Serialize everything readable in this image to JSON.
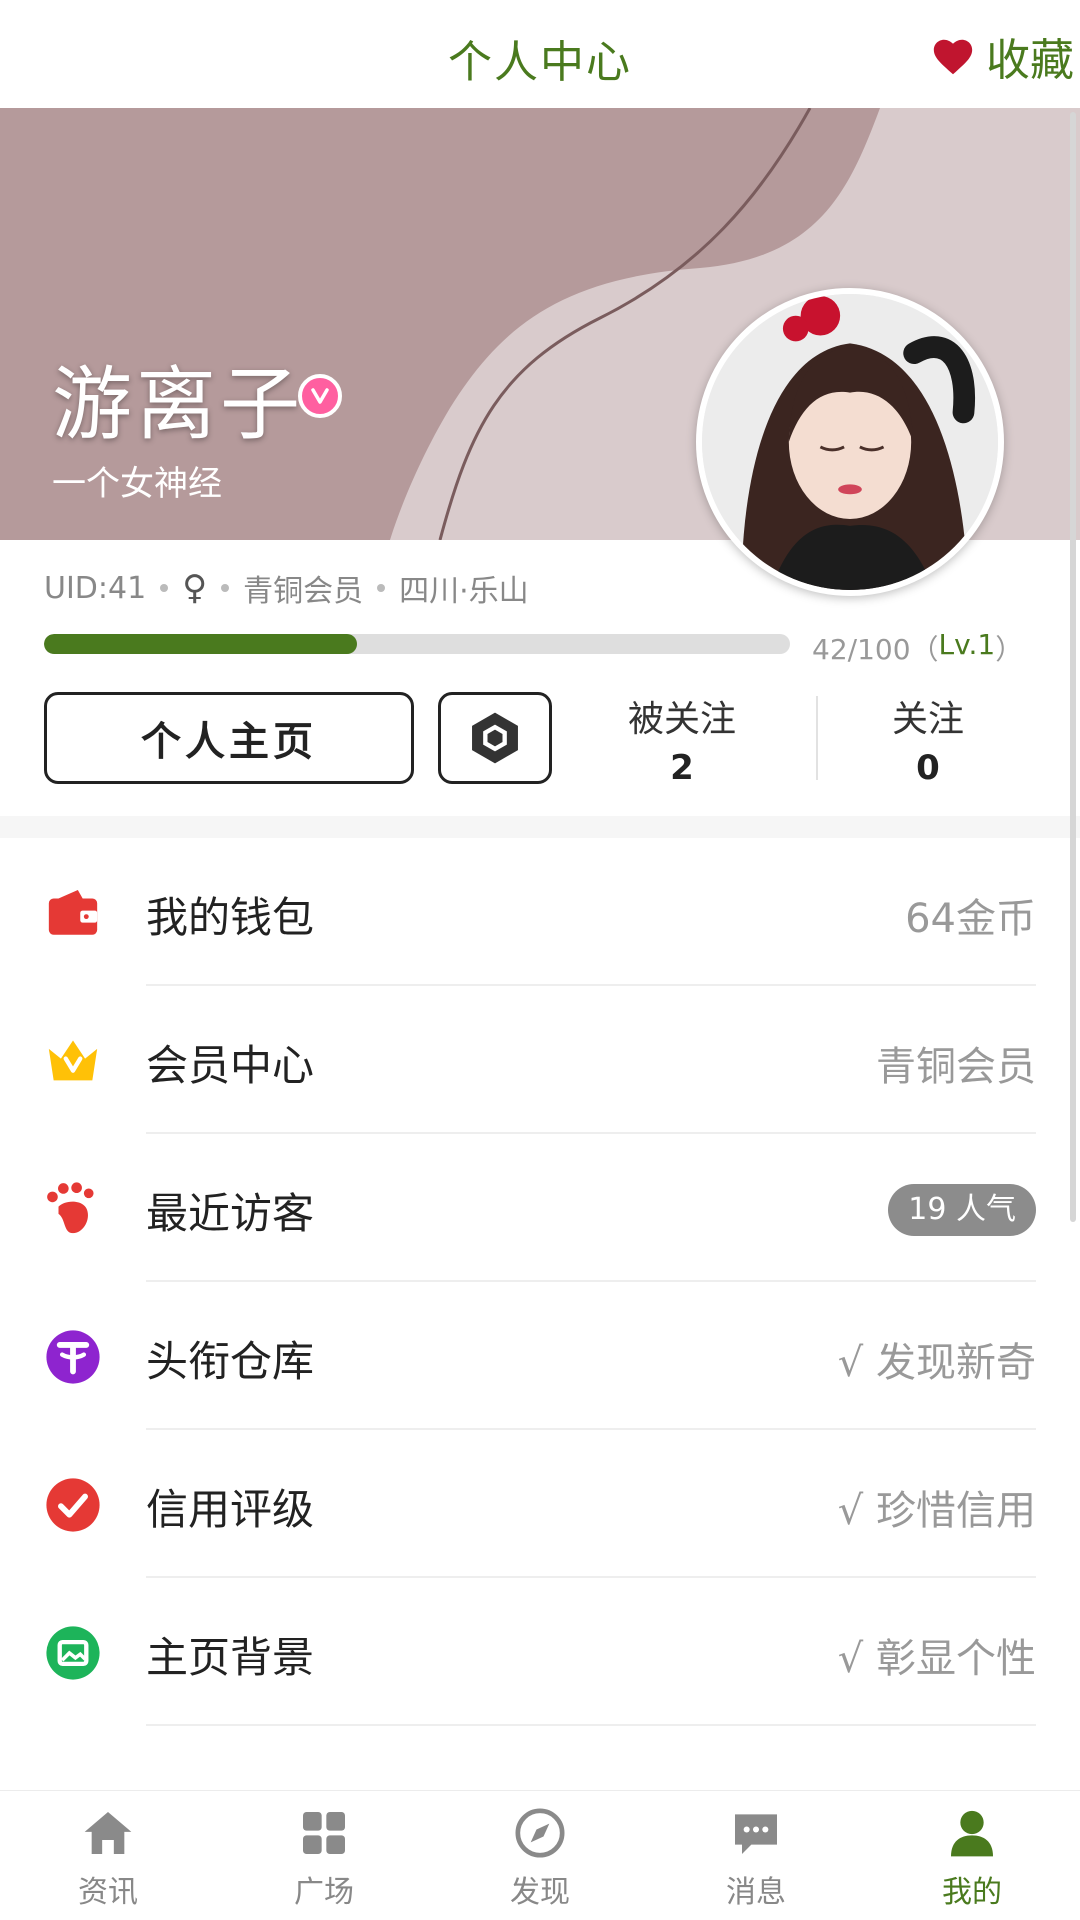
{
  "header": {
    "title": "个人中心",
    "favorite_label": "收藏"
  },
  "profile": {
    "name": "游离子",
    "signature": "一个女神经",
    "uid": "UID:41",
    "gender_symbol": "♀",
    "membership": "青铜会员",
    "location": "四川·乐山",
    "progress_text": "42/100（",
    "level": "Lv.1",
    "progress_close": "）",
    "progress_fraction": 0.42
  },
  "actions": {
    "home_button": "个人主页"
  },
  "stats": {
    "followers_label": "被关注",
    "followers_count": "2",
    "following_label": "关注",
    "following_count": "0"
  },
  "menu": [
    {
      "label": "我的钱包",
      "value": "64金币",
      "icon": "wallet-icon",
      "color": "#e53935"
    },
    {
      "label": "会员中心",
      "value": "青铜会员",
      "icon": "crown-icon",
      "color": "#ffc107"
    },
    {
      "label": "最近访客",
      "value": "19 人气",
      "icon": "footprint-icon",
      "color": "#e53935"
    },
    {
      "label": "头衔仓库",
      "value": "√ 发现新奇",
      "icon": "title-icon",
      "color": "#8e24cf"
    },
    {
      "label": "信用评级",
      "value": "√ 珍惜信用",
      "icon": "credit-icon",
      "color": "#e53935"
    },
    {
      "label": "主页背景",
      "value": "√ 彰显个性",
      "icon": "background-icon",
      "color": "#1db45a"
    }
  ],
  "tabs": [
    {
      "label": "资讯",
      "icon": "home-icon"
    },
    {
      "label": "广场",
      "icon": "grid-icon"
    },
    {
      "label": "发现",
      "icon": "compass-icon"
    },
    {
      "label": "消息",
      "icon": "chat-icon"
    },
    {
      "label": "我的",
      "icon": "user-icon",
      "active": true
    }
  ],
  "colors": {
    "accent": "#4a7a1e",
    "banner_dark": "#b59a9b",
    "banner_light": "#d9cbcc"
  }
}
